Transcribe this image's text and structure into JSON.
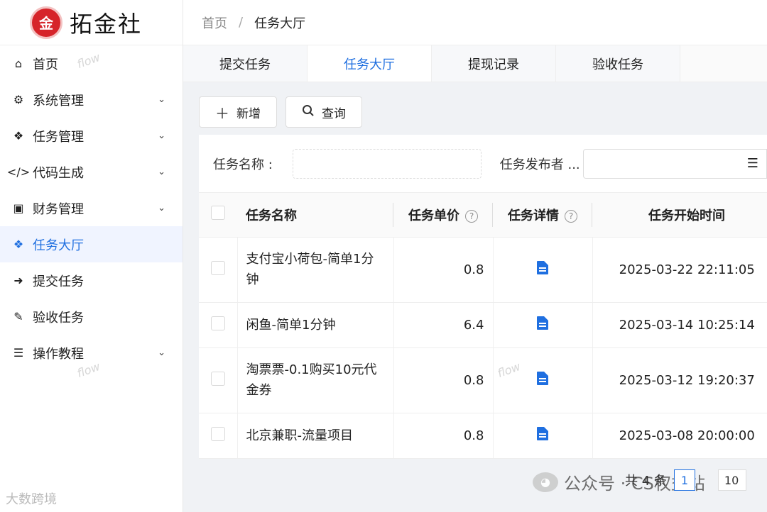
{
  "app": {
    "logo_text": "拓金社",
    "logo_mark": "金"
  },
  "sidebar": {
    "items": [
      {
        "label": "首页",
        "icon": "home-icon",
        "glyph": "⌂",
        "has_chevron": false
      },
      {
        "label": "系统管理",
        "icon": "cogs-icon",
        "glyph": "⚙",
        "has_chevron": true
      },
      {
        "label": "任务管理",
        "icon": "cubes-icon",
        "glyph": "❖",
        "has_chevron": true
      },
      {
        "label": "代码生成",
        "icon": "code-icon",
        "glyph": "</>",
        "has_chevron": true
      },
      {
        "label": "财务管理",
        "icon": "money-icon",
        "glyph": "▣",
        "has_chevron": true
      },
      {
        "label": "任务大厅",
        "icon": "cubes-icon",
        "glyph": "❖",
        "has_chevron": false
      },
      {
        "label": "提交任务",
        "icon": "arrow-right-icon",
        "glyph": "➜",
        "has_chevron": false
      },
      {
        "label": "验收任务",
        "icon": "magic-icon",
        "glyph": "✎",
        "has_chevron": false
      },
      {
        "label": "操作教程",
        "icon": "list-icon",
        "glyph": "☰",
        "has_chevron": true
      }
    ],
    "active_index": 5
  },
  "header": {
    "breadcrumb_home": "首页",
    "breadcrumb_sep": "/",
    "breadcrumb_current": "任务大厅"
  },
  "tabs": [
    {
      "label": "提交任务"
    },
    {
      "label": "任务大厅"
    },
    {
      "label": "提现记录"
    },
    {
      "label": "验收任务"
    }
  ],
  "toolbar": {
    "add_label": "新增",
    "query_label": "查询"
  },
  "search": {
    "name_label": "任务名称 :",
    "name_value": "",
    "publisher_label": "任务发布者 ...",
    "publisher_value": ""
  },
  "table": {
    "columns": {
      "name": "任务名称",
      "price": "任务单价",
      "detail": "任务详情",
      "start_time": "任务开始时间"
    },
    "rows": [
      {
        "name": "支付宝小荷包-简单1分钟",
        "price": "0.8",
        "start_time": "2025-03-22 22:11:05"
      },
      {
        "name": "闲鱼-简单1分钟",
        "price": "6.4",
        "start_time": "2025-03-14 10:25:14"
      },
      {
        "name": "淘票票-0.1购买10元代金券",
        "price": "0.8",
        "start_time": "2025-03-12 19:20:37"
      },
      {
        "name": "北京兼职-流量项目",
        "price": "0.8",
        "start_time": "2025-03-08 20:00:00"
      }
    ]
  },
  "footer": {
    "total_text": "共 4 条",
    "current_page": "1",
    "page_size": "10"
  },
  "overlay": {
    "publisher_text": "公众号 · CS权益站",
    "bottom_watermark": "大数跨境",
    "flow_watermark": "flow"
  },
  "colors": {
    "accent": "#1f6fe0",
    "brand_red": "#d6242a"
  }
}
